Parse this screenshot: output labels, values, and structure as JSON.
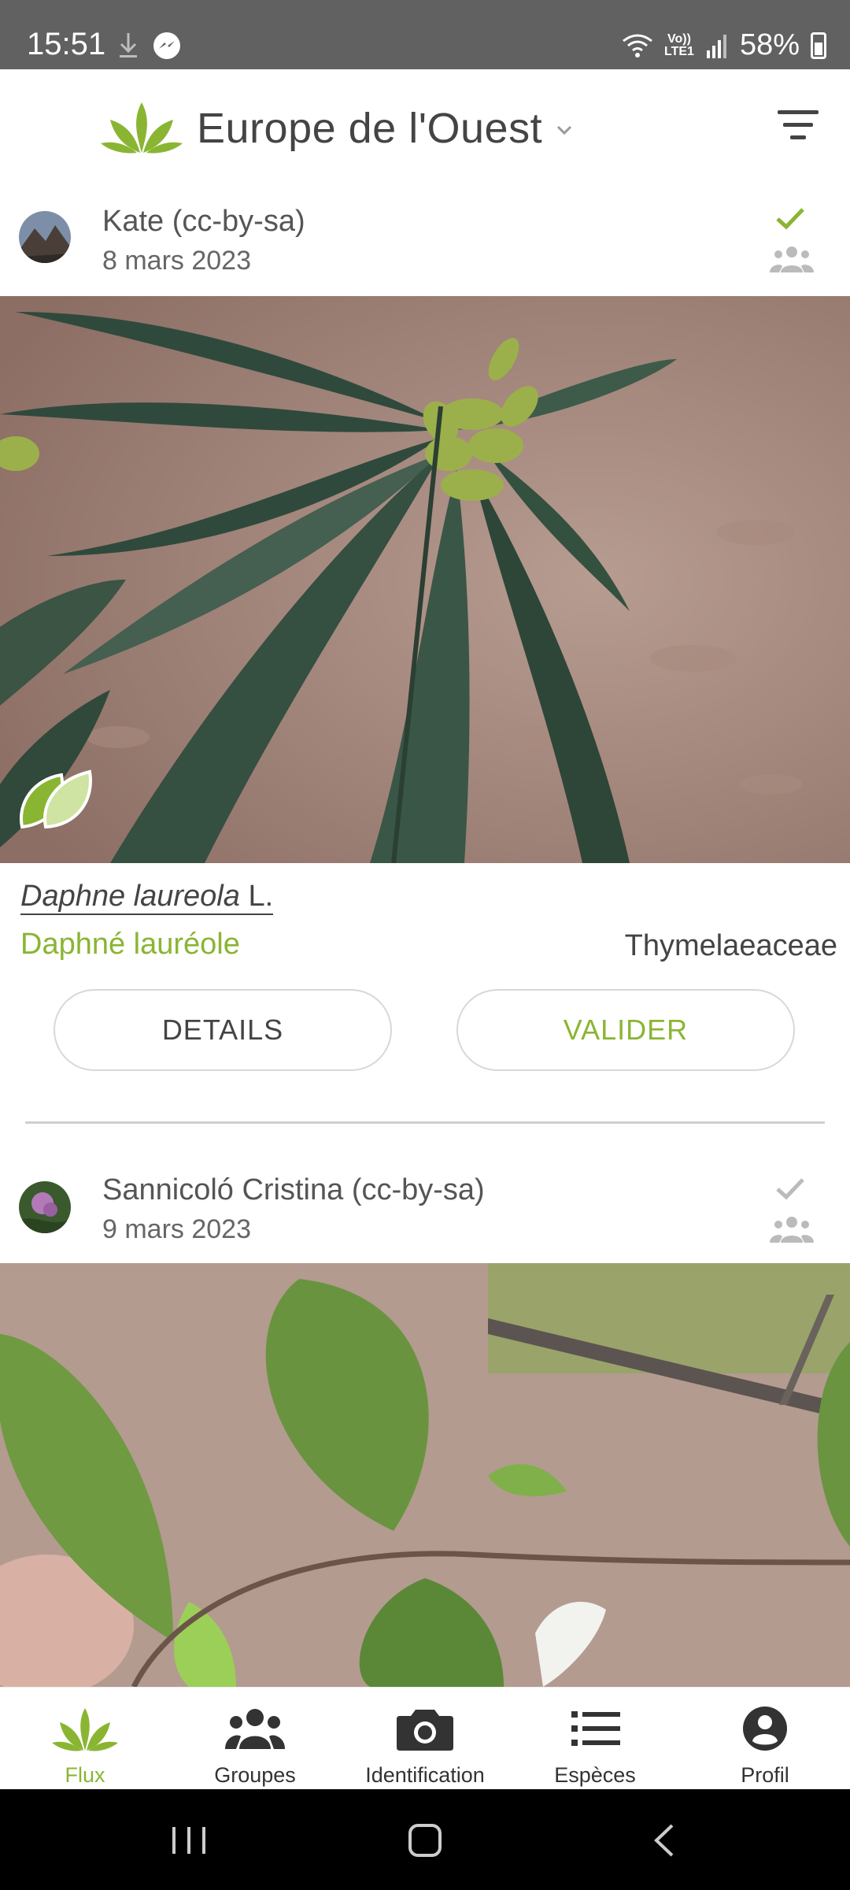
{
  "status_bar": {
    "time": "15:51",
    "battery": "58%",
    "network": "LTE1",
    "volte": "Vo))"
  },
  "header": {
    "region": "Europe de l'Ouest"
  },
  "posts": [
    {
      "author": "Kate (cc-by-sa)",
      "date": "8 mars 2023",
      "validated": true,
      "scientific_name_genus_species": "Daphne laureola",
      "scientific_name_author": "L.",
      "common_name": "Daphné lauréole",
      "family": "Thymelaeaceae",
      "details_label": "DETAILS",
      "validate_label": "VALIDER"
    },
    {
      "author": "Sannicoló Cristina (cc-by-sa)",
      "date": "9 mars 2023",
      "validated": false
    }
  ],
  "bottom_nav": [
    {
      "label": "Flux",
      "icon": "plant-icon",
      "active": true
    },
    {
      "label": "Groupes",
      "icon": "group-icon",
      "active": false
    },
    {
      "label": "Identification",
      "icon": "camera-icon",
      "active": false
    },
    {
      "label": "Espèces",
      "icon": "list-icon",
      "active": false
    },
    {
      "label": "Profil",
      "icon": "profile-icon",
      "active": false
    }
  ],
  "colors": {
    "accent": "#8ab533",
    "status_bar": "#616161",
    "text": "#444444"
  }
}
